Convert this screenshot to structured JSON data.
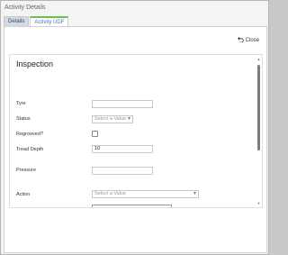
{
  "window": {
    "title": "Activity Details"
  },
  "tabs": [
    {
      "label": "Details"
    },
    {
      "label": "Activity UDF"
    }
  ],
  "close_label": "Close",
  "form": {
    "section_title": "Inspection",
    "fields": {
      "tyre": {
        "label": "Tyre",
        "value": ""
      },
      "status": {
        "label": "Status",
        "placeholder": "Select a Value"
      },
      "regrooved": {
        "label": "Regrooved?",
        "checked": false
      },
      "tread_depth": {
        "label": "Tread Depth",
        "value": "10"
      },
      "pressure": {
        "label": "Pressure",
        "value": ""
      },
      "action": {
        "label": "Action",
        "placeholder": "Select a Value"
      }
    }
  }
}
